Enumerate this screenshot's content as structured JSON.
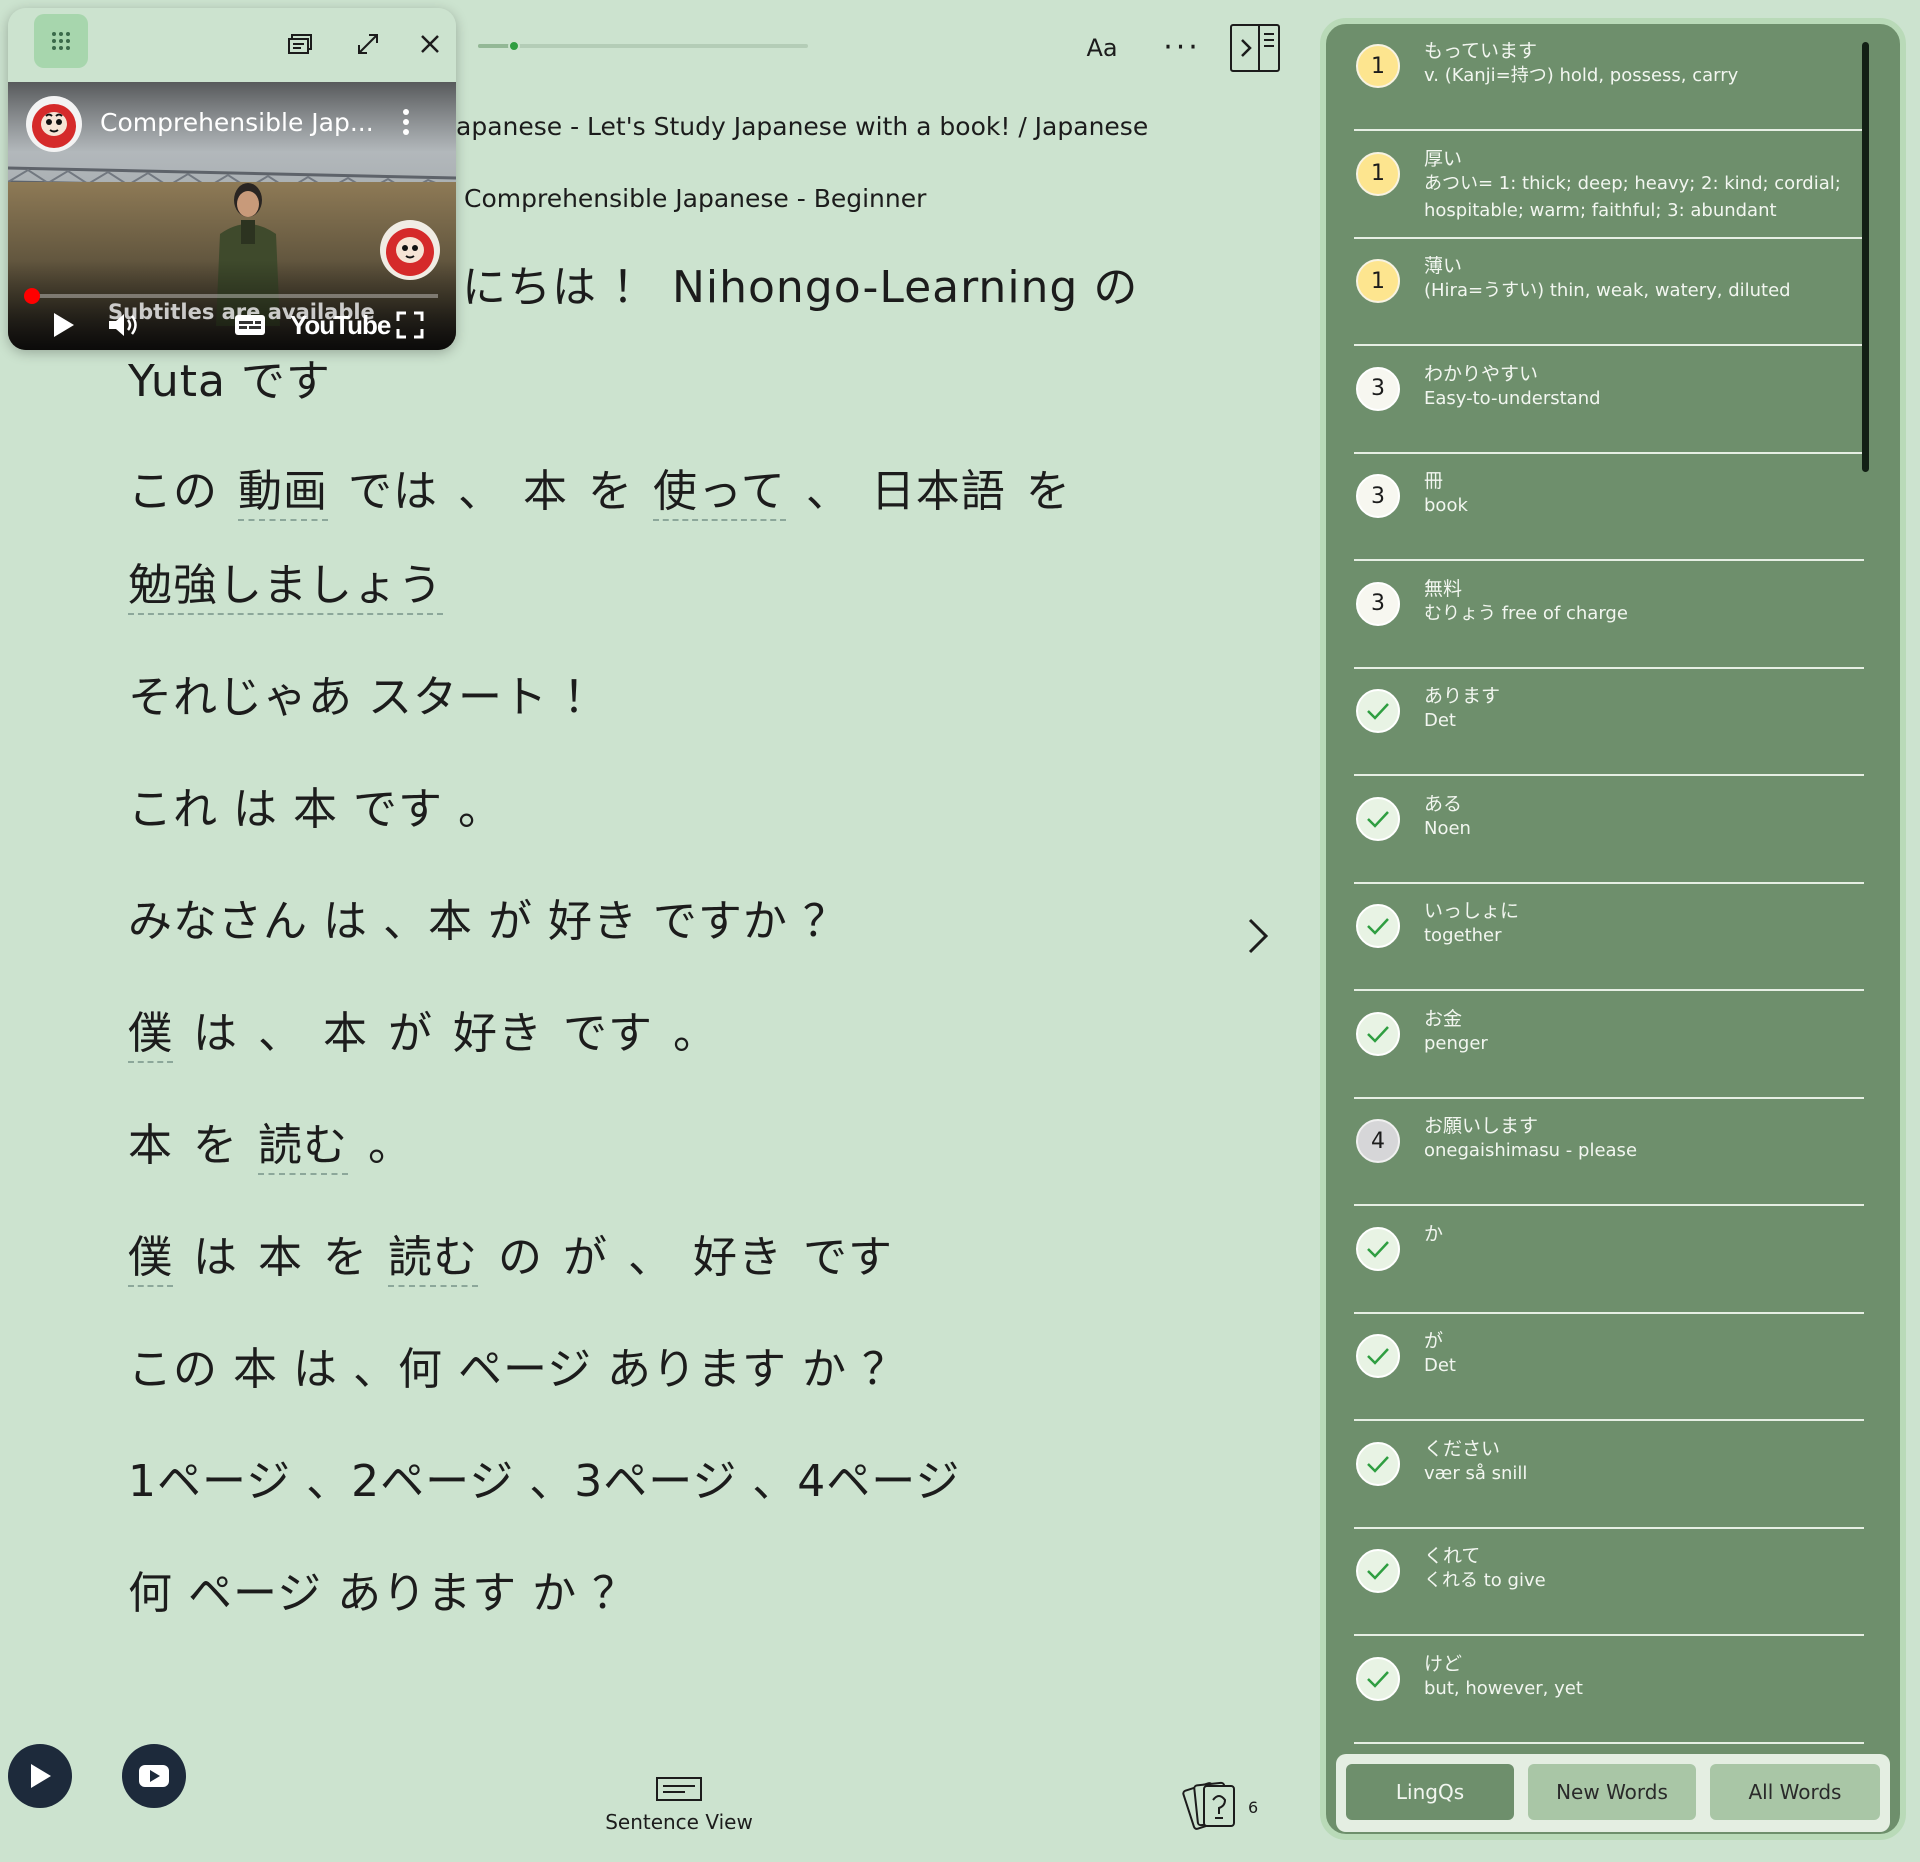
{
  "lesson": {
    "title_line1": "apanese - Let's Study Japanese with a book! / Japanese",
    "title_line2": "Comprehensible Japanese - Beginner",
    "progress_percent": 8
  },
  "toolbar": {
    "font_label": "Aa",
    "more_label": "···"
  },
  "video": {
    "title": "Comprehensible Jap...",
    "subtitle_notice": "Subtitles are available",
    "logo_text": "YouTube",
    "progress_percent": 1
  },
  "text": {
    "line1": "にちは ！ Nihongo-Learning の",
    "line2": "Yuta です",
    "line3": [
      "この",
      "動画",
      "では",
      "、",
      "本",
      "を",
      "使って",
      "、",
      "日本語",
      "を"
    ],
    "line4": "勉強しましょう",
    "line5": "それじゃあ スタート ！",
    "line6": "これ は 本 です 。",
    "line7": "みなさん は 、本 が 好き ですか ？",
    "line8": [
      "僕",
      "は",
      "、",
      "本",
      "が",
      "好き",
      "です",
      "。"
    ],
    "line9": [
      "本",
      "を",
      "読む",
      "。"
    ],
    "line10": [
      "僕",
      "は",
      "本",
      "を",
      "読む",
      "の",
      "が",
      "、",
      "好き",
      "です"
    ],
    "line11": "この 本 は 、何 ページ あります か ？",
    "line12": "1ページ 、2ページ 、3ページ 、4ページ",
    "line13": "何 ページ あります か ？"
  },
  "bottom": {
    "sentence_view_label": "Sentence View",
    "cards_count": "6"
  },
  "words": [
    {
      "status": "1",
      "term": "もっています",
      "meaning": "v. (Kanji=持つ) hold, possess, carry"
    },
    {
      "status": "1",
      "term": "厚い",
      "meaning": "あつい= 1: thick; deep; heavy; 2: kind; cordial; hospitable; warm; faithful; 3: abundant"
    },
    {
      "status": "1",
      "term": "薄い",
      "meaning": "(Hira=うすい) thin, weak, watery, diluted"
    },
    {
      "status": "3",
      "term": "わかりやすい",
      "meaning": "Easy-to-understand"
    },
    {
      "status": "3",
      "term": "冊",
      "meaning": "book"
    },
    {
      "status": "3",
      "term": "無料",
      "meaning": "むりょう free of charge"
    },
    {
      "status": "known",
      "term": "あります",
      "meaning": "Det"
    },
    {
      "status": "known",
      "term": "ある",
      "meaning": "Noen"
    },
    {
      "status": "known",
      "term": "いっしょに",
      "meaning": "together"
    },
    {
      "status": "known",
      "term": "お金",
      "meaning": "penger"
    },
    {
      "status": "4",
      "term": "お願いします",
      "meaning": "onegaishimasu - please"
    },
    {
      "status": "known",
      "term": "か",
      "meaning": ""
    },
    {
      "status": "known",
      "term": "が",
      "meaning": "Det"
    },
    {
      "status": "known",
      "term": "ください",
      "meaning": "vær så snill"
    },
    {
      "status": "known",
      "term": "くれて",
      "meaning": "くれる to give"
    },
    {
      "status": "known",
      "term": "けど",
      "meaning": "but, however, yet"
    }
  ],
  "tabs": [
    "LingQs",
    "New Words",
    "All Words"
  ],
  "colors": {
    "background": "#cce3cf",
    "panel": "#6e8f6c",
    "level1": "#fde58f",
    "known_check": "#2f9e41"
  }
}
